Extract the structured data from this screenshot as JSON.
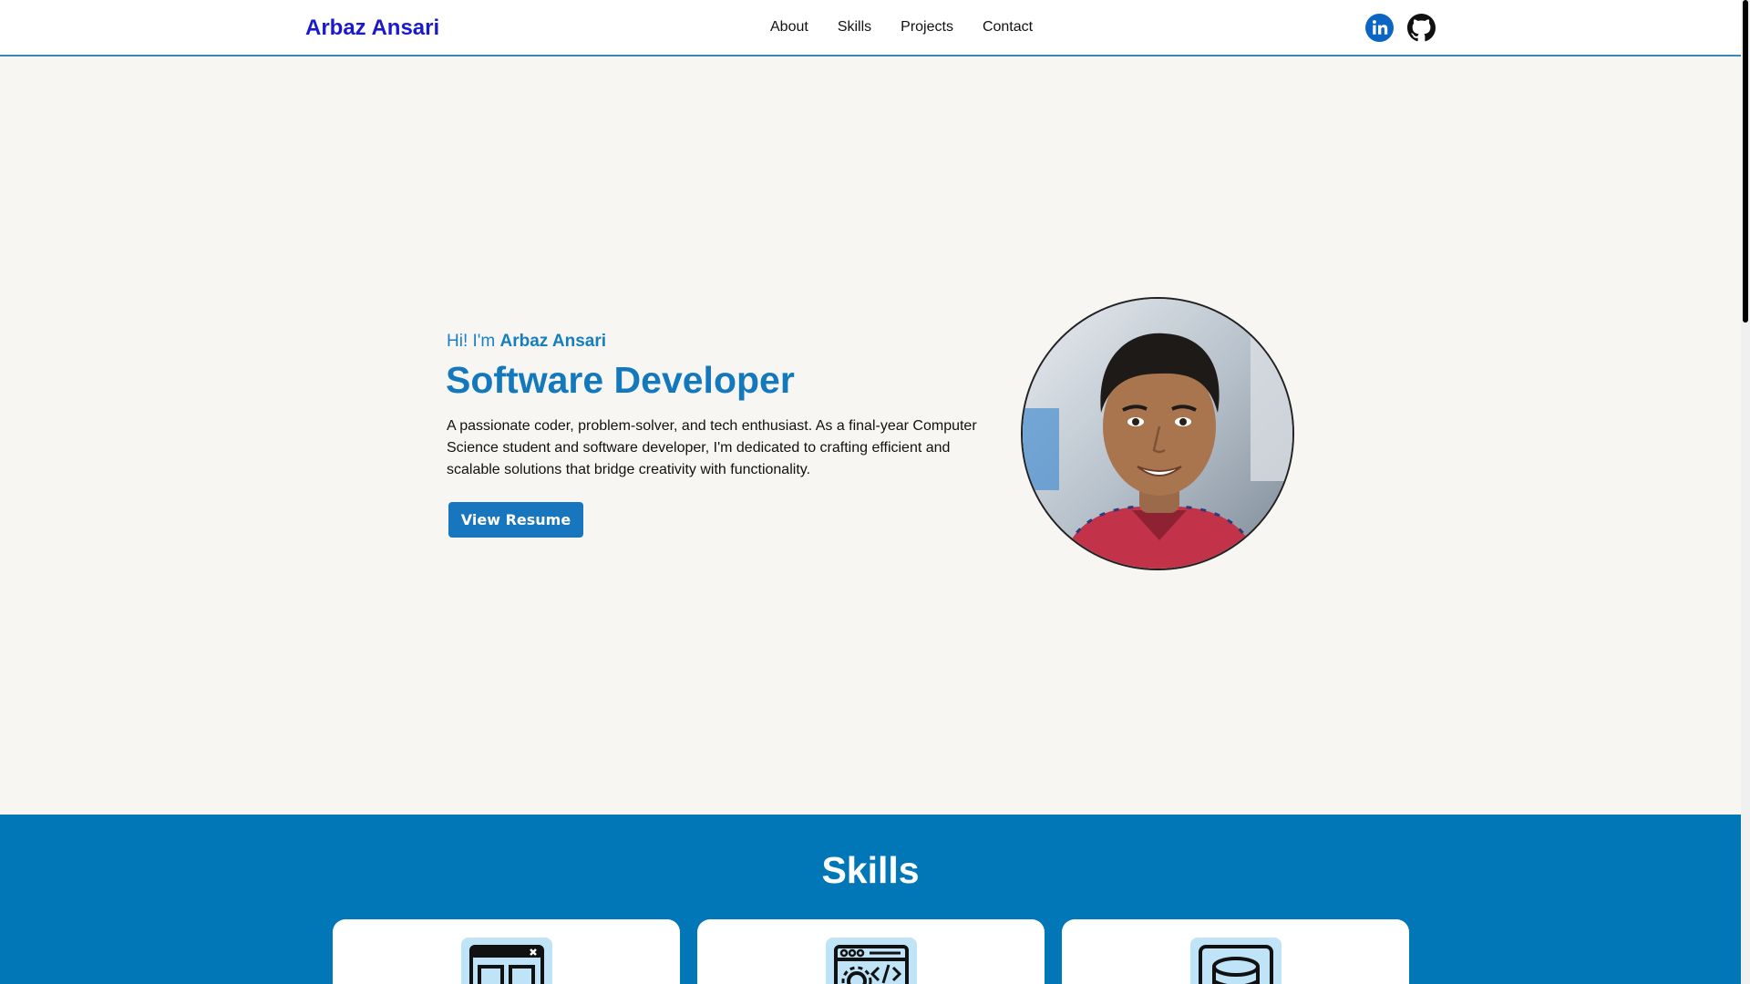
{
  "nav": {
    "brand": "Arbaz Ansari",
    "links": [
      "About",
      "Skills",
      "Projects",
      "Contact"
    ]
  },
  "social": {
    "linkedin_icon": "linkedin-icon",
    "github_icon": "github-icon"
  },
  "hero": {
    "greeting": "Hi! I'm ",
    "name": "Arbaz Ansari",
    "title": "Software Developer",
    "description": "A passionate coder, problem-solver, and tech enthusiast. As a final-year Computer Science student and software developer, I'm dedicated to crafting efficient and scalable solutions that bridge creativity with functionality.",
    "resume_button": "View Resume"
  },
  "skills": {
    "title": "Skills",
    "cards": [
      {
        "icon": "web-layout-icon"
      },
      {
        "icon": "code-settings-icon"
      },
      {
        "icon": "database-icon"
      }
    ]
  },
  "colors": {
    "brand": "#1a1acc",
    "primary": "#1776bd",
    "skills_bg": "#0277b8"
  }
}
